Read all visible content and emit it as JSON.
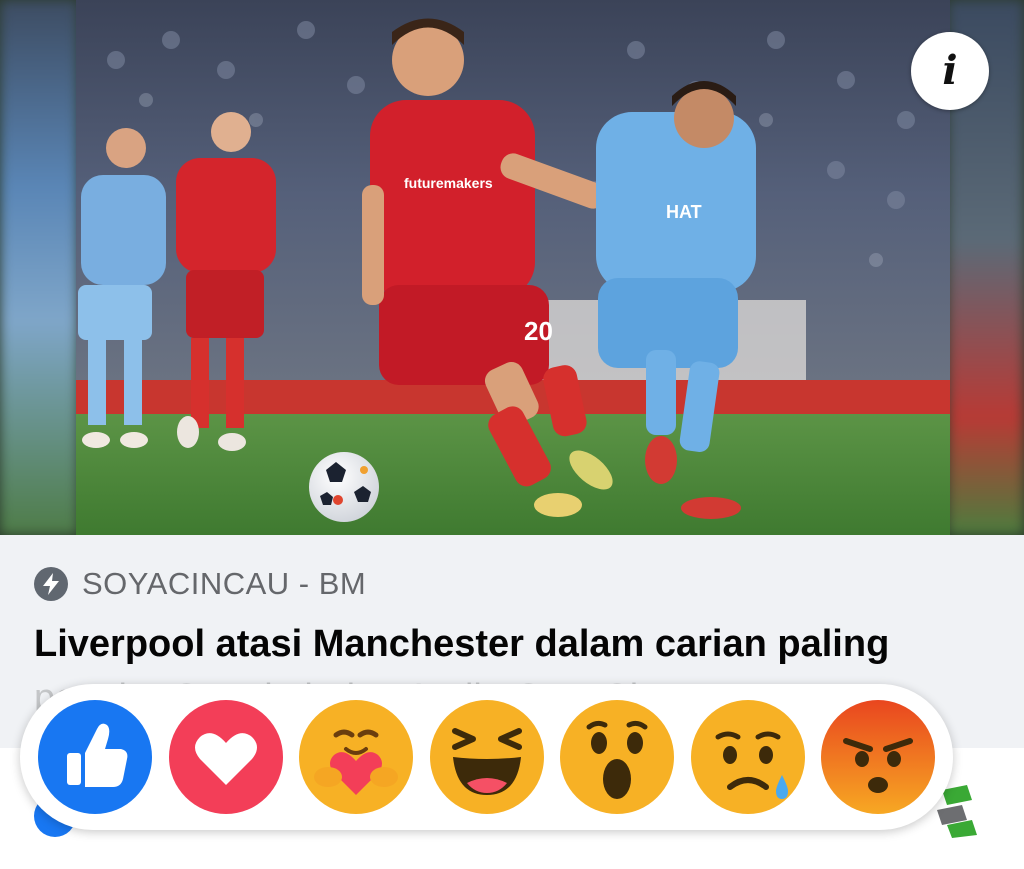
{
  "post": {
    "source": "SOYACINCAU - BM",
    "headline_line1": "Liverpool atasi Manchester dalam carian paling",
    "headline_line2": "popular Google bulan April - SoyaCincau.com",
    "info_label": "i"
  },
  "reactions": [
    {
      "name": "like",
      "icon": "thumbs-up-icon",
      "color": "#1877f2"
    },
    {
      "name": "love",
      "icon": "heart-icon",
      "color": "#f33e58"
    },
    {
      "name": "care",
      "icon": "care-hug-icon",
      "color": "#f7b125"
    },
    {
      "name": "haha",
      "icon": "laughing-face-icon",
      "color": "#f7b125"
    },
    {
      "name": "wow",
      "icon": "surprised-face-icon",
      "color": "#f7b125"
    },
    {
      "name": "sad",
      "icon": "sad-face-icon",
      "color": "#f7b125"
    },
    {
      "name": "angry",
      "icon": "angry-face-icon",
      "color": "#e9710f"
    }
  ],
  "colors": {
    "facebook_blue": "#1877f2",
    "liverpool_red": "#c8102e",
    "city_blue": "#6cabdd",
    "pitch_green": "#4e8a3a"
  }
}
